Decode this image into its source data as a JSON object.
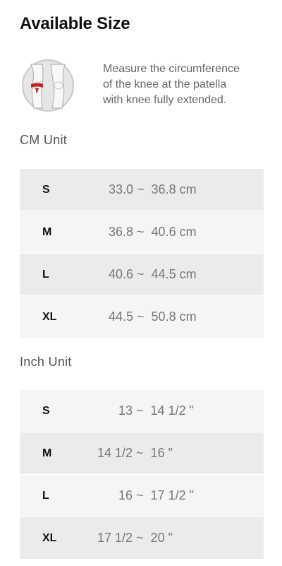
{
  "title": "Available Size",
  "illustration": {
    "icon": "knee-measurement-icon",
    "band_color": "#c0272d"
  },
  "instruction": {
    "line1": "Measure the circumference",
    "line2": "of the knee at the patella",
    "line3": "with knee fully extended."
  },
  "cm_section": {
    "label": "CM Unit",
    "rows": [
      {
        "size": "S",
        "range": "33.0 ~  36.8 cm"
      },
      {
        "size": "M",
        "range": "36.8 ~  40.6 cm"
      },
      {
        "size": "L",
        "range": "40.6 ~  44.5 cm"
      },
      {
        "size": "XL",
        "range": "44.5 ~  50.8 cm"
      }
    ]
  },
  "inch_section": {
    "label": "Inch Unit",
    "rows": [
      {
        "size": "S",
        "range": "        13 ~  14 1/2 \""
      },
      {
        "size": "M",
        "range": "  14 1/2 ~  16 \""
      },
      {
        "size": "L",
        "range": "        16 ~  17 1/2 \""
      },
      {
        "size": "XL",
        "range": "  17 1/2 ~  20 \""
      }
    ]
  },
  "colors": {
    "row_alt": "#ebebeb",
    "row_plain": "#f5f5f5"
  }
}
